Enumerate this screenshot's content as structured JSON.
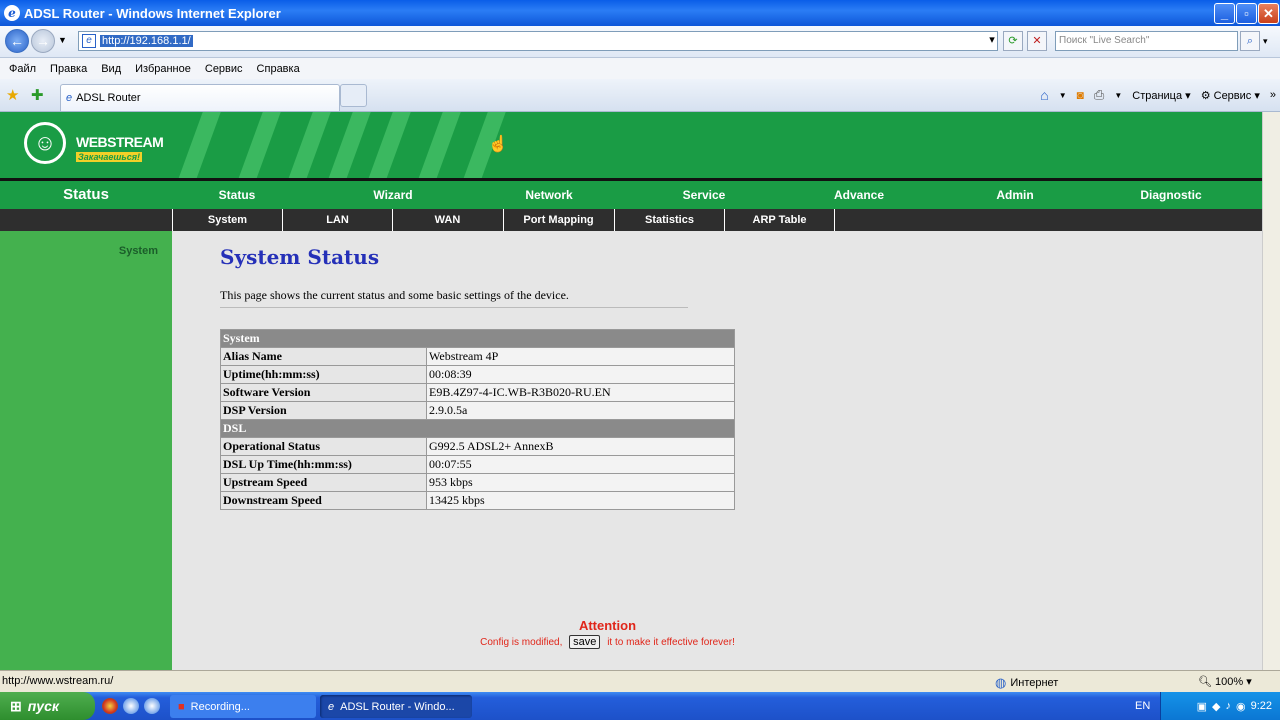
{
  "window": {
    "title": "ADSL Router - Windows Internet Explorer"
  },
  "address": {
    "url": "http://192.168.1.1/",
    "search_placeholder": "Поиск \"Live Search\""
  },
  "menu": [
    "Файл",
    "Правка",
    "Вид",
    "Избранное",
    "Сервис",
    "Справка"
  ],
  "tab": {
    "title": "ADSL Router"
  },
  "toolbar": {
    "page_label": "Страница",
    "tools_label": "Сервис"
  },
  "banner": {
    "brand": "WEBSTREAM",
    "slogan": "Закачаешься!"
  },
  "mainnav": {
    "current": "Status",
    "items": [
      "Status",
      "Wizard",
      "Network",
      "Service",
      "Advance",
      "Admin",
      "Diagnostic"
    ]
  },
  "subnav": [
    "System",
    "LAN",
    "WAN",
    "Port Mapping",
    "Statistics",
    "ARP Table"
  ],
  "sidebar": {
    "item": "System"
  },
  "content": {
    "title": "System Status",
    "description": "This page shows the current status and some basic settings of the device.",
    "system_header": "System",
    "system_rows": [
      {
        "label": "Alias Name",
        "value": "Webstream 4P"
      },
      {
        "label": "Uptime(hh:mm:ss)",
        "value": "00:08:39"
      },
      {
        "label": "Software Version",
        "value": "E9B.4Z97-4-IC.WB-R3B020-RU.EN"
      },
      {
        "label": "DSP Version",
        "value": "2.9.0.5a"
      }
    ],
    "dsl_header": "DSL",
    "dsl_rows": [
      {
        "label": "Operational Status",
        "value": "G992.5 ADSL2+ AnnexB"
      },
      {
        "label": "DSL Up Time(hh:mm:ss)",
        "value": "00:07:55"
      },
      {
        "label": "Upstream Speed",
        "value": "953 kbps"
      },
      {
        "label": "Downstream Speed",
        "value": "13425 kbps"
      }
    ]
  },
  "attention": {
    "title": "Attention",
    "before": "Config is modified,",
    "button": "save",
    "after": "it to make it effective forever!"
  },
  "statusbar": {
    "url": "http://www.wstream.ru/",
    "zone": "Интернет",
    "zoom": "100%"
  },
  "taskbar": {
    "start": "пуск",
    "tasks": [
      "Recording...",
      "ADSL Router - Windo..."
    ],
    "lang": "EN",
    "clock": "9:22"
  }
}
